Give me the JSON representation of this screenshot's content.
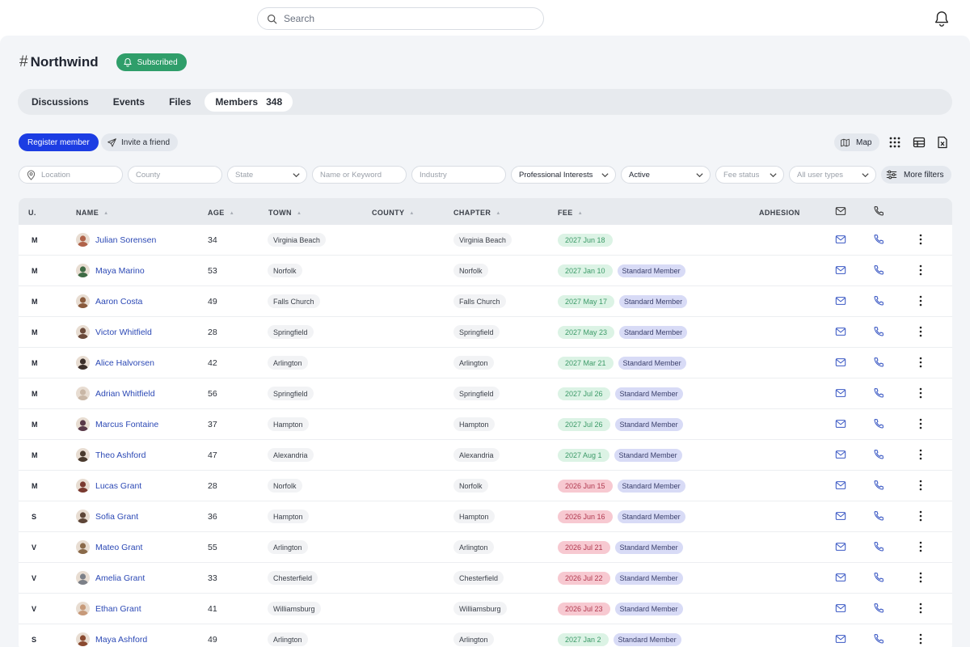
{
  "search": {
    "placeholder": "Search"
  },
  "group": {
    "hash": "#",
    "title": "Northwind",
    "subscribed_label": "Subscribed"
  },
  "tabs": [
    {
      "label": "Discussions"
    },
    {
      "label": "Events"
    },
    {
      "label": "Files"
    },
    {
      "label": "Members",
      "count": "348",
      "active": true
    }
  ],
  "actions": {
    "register_label": "Register member",
    "invite_label": "Invite a friend",
    "map_label": "Map"
  },
  "filters": {
    "location_placeholder": "Location",
    "county_placeholder": "County",
    "state_placeholder": "State",
    "keyword_placeholder": "Name or Keyword",
    "industry_placeholder": "Industry",
    "interests_value": "Professional Interests",
    "status_value": "Active",
    "fee_status_placeholder": "Fee status",
    "user_types_placeholder": "All user types",
    "more_filters_label": "More filters"
  },
  "table": {
    "headers": {
      "u": "U.",
      "name": "NAME",
      "age": "AGE",
      "town": "TOWN",
      "county": "COUNTY",
      "chapter": "CHAPTER",
      "fee": "FEE",
      "adhesion": "ADHESION"
    },
    "rows": [
      {
        "u": "M",
        "name": "Julian Sorensen",
        "age": "34",
        "town": "Virginia Beach",
        "chapter": "Virginia Beach",
        "fee": "2027 Jun 18",
        "fee_status": "green",
        "adhesion": "",
        "avatar_color": "#b0634a"
      },
      {
        "u": "M",
        "name": "Maya Marino",
        "age": "53",
        "town": "Norfolk",
        "chapter": "Norfolk",
        "fee": "2027 Jan 10",
        "fee_status": "green",
        "adhesion": "Standard Member",
        "avatar_color": "#3f6b45"
      },
      {
        "u": "M",
        "name": "Aaron Costa",
        "age": "49",
        "town": "Falls Church",
        "chapter": "Falls Church",
        "fee": "2027 May 17",
        "fee_status": "green",
        "adhesion": "Standard Member",
        "avatar_color": "#8a5a3c"
      },
      {
        "u": "M",
        "name": "Victor Whitfield",
        "age": "28",
        "town": "Springfield",
        "chapter": "Springfield",
        "fee": "2027 May 23",
        "fee_status": "green",
        "adhesion": "Standard Member",
        "avatar_color": "#6b4a3a"
      },
      {
        "u": "M",
        "name": "Alice Halvorsen",
        "age": "42",
        "town": "Arlington",
        "chapter": "Arlington",
        "fee": "2027 Mar 21",
        "fee_status": "green",
        "adhesion": "Standard Member",
        "avatar_color": "#3c2f2a"
      },
      {
        "u": "M",
        "name": "Adrian Whitfield",
        "age": "56",
        "town": "Springfield",
        "chapter": "Springfield",
        "fee": "2027 Jul 26",
        "fee_status": "green",
        "adhesion": "Standard Member",
        "avatar_color": "#c9b7a6"
      },
      {
        "u": "M",
        "name": "Marcus Fontaine",
        "age": "37",
        "town": "Hampton",
        "chapter": "Hampton",
        "fee": "2027 Jul 26",
        "fee_status": "green",
        "adhesion": "Standard Member",
        "avatar_color": "#5a3a4a"
      },
      {
        "u": "M",
        "name": "Theo Ashford",
        "age": "47",
        "town": "Alexandria",
        "chapter": "Alexandria",
        "fee": "2027 Aug 1",
        "fee_status": "green",
        "adhesion": "Standard Member",
        "avatar_color": "#4a3a2e"
      },
      {
        "u": "M",
        "name": "Lucas Grant",
        "age": "28",
        "town": "Norfolk",
        "chapter": "Norfolk",
        "fee": "2026 Jun 15",
        "fee_status": "red",
        "adhesion": "Standard Member",
        "avatar_color": "#7a3a30"
      },
      {
        "u": "S",
        "name": "Sofia Grant",
        "age": "36",
        "town": "Hampton",
        "chapter": "Hampton",
        "fee": "2026 Jun 16",
        "fee_status": "red",
        "adhesion": "Standard Member",
        "avatar_color": "#5e4638"
      },
      {
        "u": "V",
        "name": "Mateo Grant",
        "age": "55",
        "town": "Arlington",
        "chapter": "Arlington",
        "fee": "2026 Jul 21",
        "fee_status": "red",
        "adhesion": "Standard Member",
        "avatar_color": "#8a6a4a"
      },
      {
        "u": "V",
        "name": "Amelia Grant",
        "age": "33",
        "town": "Chesterfield",
        "chapter": "Chesterfield",
        "fee": "2026 Jul 22",
        "fee_status": "red",
        "adhesion": "Standard Member",
        "avatar_color": "#7c8088"
      },
      {
        "u": "V",
        "name": "Ethan Grant",
        "age": "41",
        "town": "Williamsburg",
        "chapter": "Williamsburg",
        "fee": "2026 Jul 23",
        "fee_status": "red",
        "adhesion": "Standard Member",
        "avatar_color": "#c79a7a"
      },
      {
        "u": "S",
        "name": "Maya Ashford",
        "age": "49",
        "town": "Arlington",
        "chapter": "Arlington",
        "fee": "2027 Jan 2",
        "fee_status": "green",
        "adhesion": "Standard Member",
        "avatar_color": "#8a4a30"
      }
    ]
  },
  "colors": {
    "accent": "#1c3de3",
    "subscribed": "#2f9e6a",
    "link": "#2c49b5",
    "fee_paid_bg": "#dcf3e5",
    "fee_overdue_bg": "#f7c9d1",
    "adhesion_bg": "#d8dbf6"
  }
}
